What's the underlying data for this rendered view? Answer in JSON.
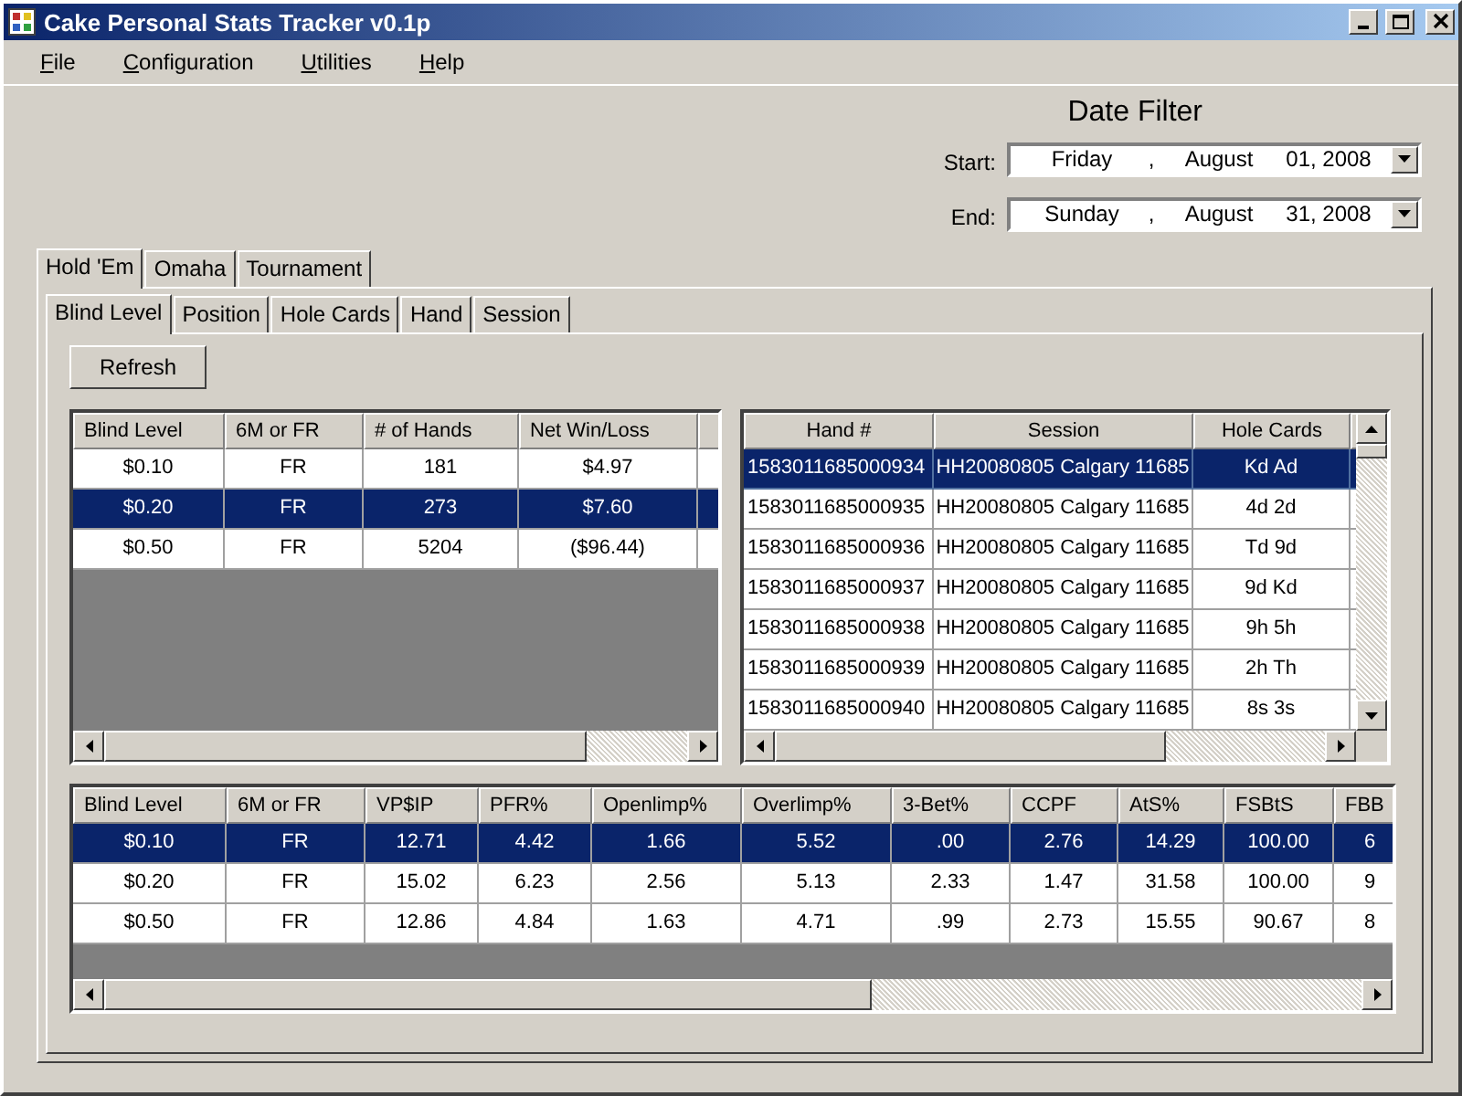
{
  "window": {
    "title": "Cake Personal Stats Tracker v0.1p"
  },
  "menu": [
    "File",
    "Configuration",
    "Utilities",
    "Help"
  ],
  "date_filter": {
    "title": "Date Filter",
    "pickers": [
      {
        "label": "Start:",
        "weekday": "Friday",
        "separator": ",",
        "month": "August",
        "date": "01, 2008"
      },
      {
        "label": "End:",
        "weekday": "Sunday",
        "separator": ",",
        "month": "August",
        "date": "31, 2008"
      }
    ]
  },
  "outer_tabs": [
    {
      "label": "Hold 'Em",
      "selected": true
    },
    {
      "label": "Omaha",
      "selected": false
    },
    {
      "label": "Tournament",
      "selected": false
    }
  ],
  "inner_tabs": [
    {
      "label": "Blind Level",
      "selected": true
    },
    {
      "label": "Position",
      "selected": false
    },
    {
      "label": "Hole Cards",
      "selected": false
    },
    {
      "label": "Hand",
      "selected": false
    },
    {
      "label": "Session",
      "selected": false
    }
  ],
  "refresh_button": "Refresh",
  "blind_table": {
    "columns": [
      "Blind Level",
      "6M or FR",
      "# of Hands",
      "Net Win/Loss"
    ],
    "rows": [
      {
        "selected": false,
        "cells": [
          "$0.10",
          "FR",
          "181",
          "$4.97"
        ]
      },
      {
        "selected": true,
        "cells": [
          "$0.20",
          "FR",
          "273",
          "$7.60"
        ]
      },
      {
        "selected": false,
        "cells": [
          "$0.50",
          "FR",
          "5204",
          "($96.44)"
        ]
      }
    ]
  },
  "hands_table": {
    "columns": [
      "Hand #",
      "Session",
      "Hole Cards"
    ],
    "rows": [
      {
        "selected": true,
        "cells": [
          "1583011685000934",
          "HH20080805 Calgary 11685",
          "Kd Ad"
        ]
      },
      {
        "selected": false,
        "cells": [
          "1583011685000935",
          "HH20080805 Calgary 11685",
          "4d 2d"
        ]
      },
      {
        "selected": false,
        "cells": [
          "1583011685000936",
          "HH20080805 Calgary 11685",
          "Td 9d"
        ]
      },
      {
        "selected": false,
        "cells": [
          "1583011685000937",
          "HH20080805 Calgary 11685",
          "9d Kd"
        ]
      },
      {
        "selected": false,
        "cells": [
          "1583011685000938",
          "HH20080805 Calgary 11685",
          "9h 5h"
        ]
      },
      {
        "selected": false,
        "cells": [
          "1583011685000939",
          "HH20080805 Calgary 11685",
          "2h Th"
        ]
      },
      {
        "selected": false,
        "cells": [
          "1583011685000940",
          "HH20080805 Calgary 11685",
          "8s 3s"
        ]
      }
    ]
  },
  "stats_table": {
    "columns": [
      "Blind Level",
      "6M or FR",
      "VP$IP",
      "PFR%",
      "Openlimp%",
      "Overlimp%",
      "3-Bet%",
      "CCPF",
      "AtS%",
      "FSBtS",
      "FBB"
    ],
    "rows": [
      {
        "selected": true,
        "cells": [
          "$0.10",
          "FR",
          "12.71",
          "4.42",
          "1.66",
          "5.52",
          ".00",
          "2.76",
          "14.29",
          "100.00",
          "6"
        ]
      },
      {
        "selected": false,
        "cells": [
          "$0.20",
          "FR",
          "15.02",
          "6.23",
          "2.56",
          "5.13",
          "2.33",
          "1.47",
          "31.58",
          "100.00",
          "9"
        ]
      },
      {
        "selected": false,
        "cells": [
          "$0.50",
          "FR",
          "12.86",
          "4.84",
          "1.63",
          "4.71",
          ".99",
          "2.73",
          "15.55",
          "90.67",
          "8"
        ]
      }
    ]
  }
}
